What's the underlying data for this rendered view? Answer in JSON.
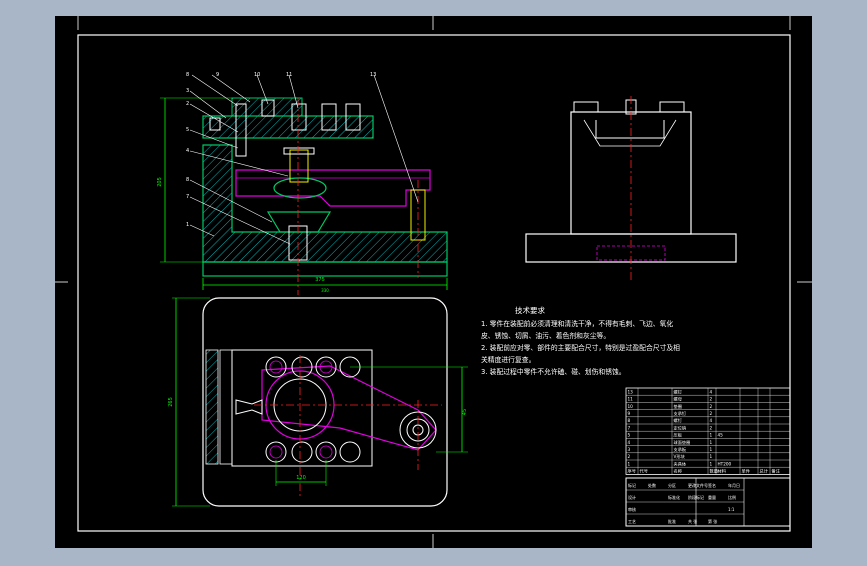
{
  "colors": {
    "backdrop": "#a9b6c7",
    "canvas": "#000000",
    "frame": "#ffffff",
    "part_green": "#00c864",
    "hatch_cyan": "#00b4b4",
    "part_magenta": "#e000e0",
    "centerline_red": "#ff2020",
    "dimension_green": "#00ff00",
    "bolt_yellow": "#f0f000",
    "callout_white": "#ffffff"
  },
  "part_numbers": [
    "8",
    "9",
    "10",
    "11",
    "13",
    "3",
    "2",
    "5",
    "4",
    "8",
    "7",
    "1"
  ],
  "dimensions": {
    "front_overall_width": "375",
    "front_overall_height": "205",
    "top_view_width": "375",
    "top_view_height": "265",
    "hole_spacing_x": "120",
    "hole_spacing_y": "45",
    "front_sub": "330"
  },
  "tech_requirements": {
    "title": "技术要求",
    "lines": [
      "1. 零件在装配前必须清理和清洗干净，不得有毛刺、飞边、氧化",
      "皮、锈蚀、切屑、油污、着色剂和灰尘等。",
      "2. 装配前应对零、部件的主要配合尺寸，特别是过盈配合尺寸及相",
      "关精度进行复查。",
      "3. 装配过程中零件不允许磕、碰、划伤和锈蚀。"
    ]
  },
  "bom_rows": [
    [
      "13",
      "螺钉",
      "4",
      "",
      ""
    ],
    [
      "11",
      "螺母",
      "2",
      "",
      ""
    ],
    [
      "10",
      "垫圈",
      "2",
      "",
      ""
    ],
    [
      "9",
      "支承钉",
      "2",
      "",
      ""
    ],
    [
      "8",
      "螺钉",
      "4",
      "",
      ""
    ],
    [
      "7",
      "定位销",
      "2",
      "",
      ""
    ],
    [
      "5",
      "压板",
      "1",
      "45",
      ""
    ],
    [
      "4",
      "球面垫圈",
      "1",
      "",
      ""
    ],
    [
      "3",
      "支承板",
      "1",
      "",
      ""
    ],
    [
      "2",
      "V形块",
      "1",
      "",
      ""
    ],
    [
      "1",
      "夹具体",
      "1",
      "HT200",
      ""
    ]
  ],
  "bom_header": [
    "序号",
    "代号",
    "名称",
    "数量",
    "材料",
    "单件",
    "总计",
    "备注"
  ],
  "title_block": {
    "row1": [
      "标记",
      "处数",
      "分区",
      "更改文件号",
      "签名",
      "年月日"
    ],
    "row2": [
      "设计",
      "",
      "标准化",
      "阶段标记",
      "重量",
      "比例"
    ],
    "row3": [
      "审核",
      "",
      "",
      "",
      "",
      "1:1"
    ],
    "row4": [
      "工艺",
      "",
      "批准",
      "共 张",
      "第 张",
      ""
    ]
  }
}
